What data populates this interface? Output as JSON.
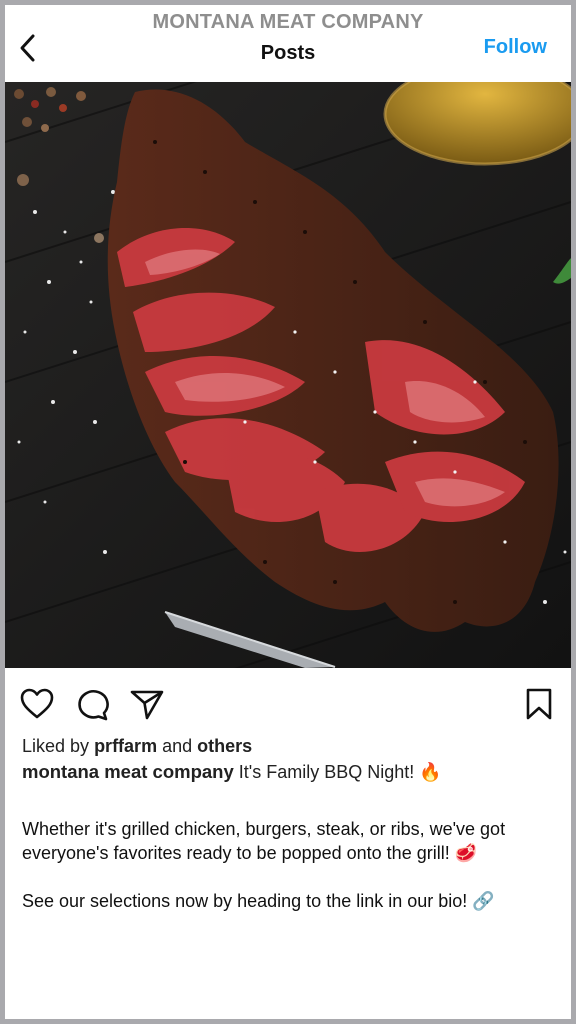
{
  "header": {
    "account": "MONTANA MEAT COMPANY",
    "title": "Posts",
    "follow_label": "Follow"
  },
  "icons": {
    "back": "chevron-left-icon",
    "like": "heart-icon",
    "comment": "comment-icon",
    "share": "send-icon",
    "save": "bookmark-icon"
  },
  "post": {
    "likes_prefix": "Liked by",
    "liked_user": "prffarm",
    "likes_and": "and",
    "likes_others": "others",
    "username": "montana meat company",
    "caption_first": "It's Family BBQ Night! 🔥",
    "paragraph_2": "Whether it's grilled chicken, burgers, steak, or ribs, we've got everyone's favorites ready to be popped onto the grill! 🥩",
    "paragraph_3": "See our selections now by heading to the link in our bio! 🔗"
  },
  "colors": {
    "accent": "#1a9bf0",
    "text": "#222222",
    "muted": "#8e8e8e"
  }
}
